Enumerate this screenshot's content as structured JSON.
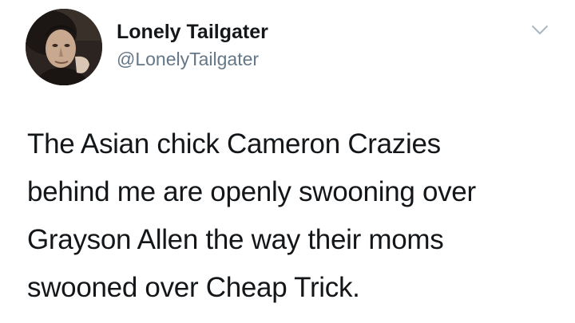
{
  "author": {
    "display_name": "Lonely Tailgater",
    "handle": "@LonelyTailgater",
    "avatar_icon": "profile-photo"
  },
  "menu": {
    "icon": "chevron-down-icon"
  },
  "tweet": {
    "lines": [
      "The Asian chick Cameron Crazies",
      "behind me are openly swooning over",
      "Grayson Allen the way their moms",
      "swooned over Cheap Trick."
    ]
  },
  "colors": {
    "text": "#14171a",
    "handle": "#657786",
    "chevron": "#aab8c2",
    "background": "#ffffff"
  }
}
